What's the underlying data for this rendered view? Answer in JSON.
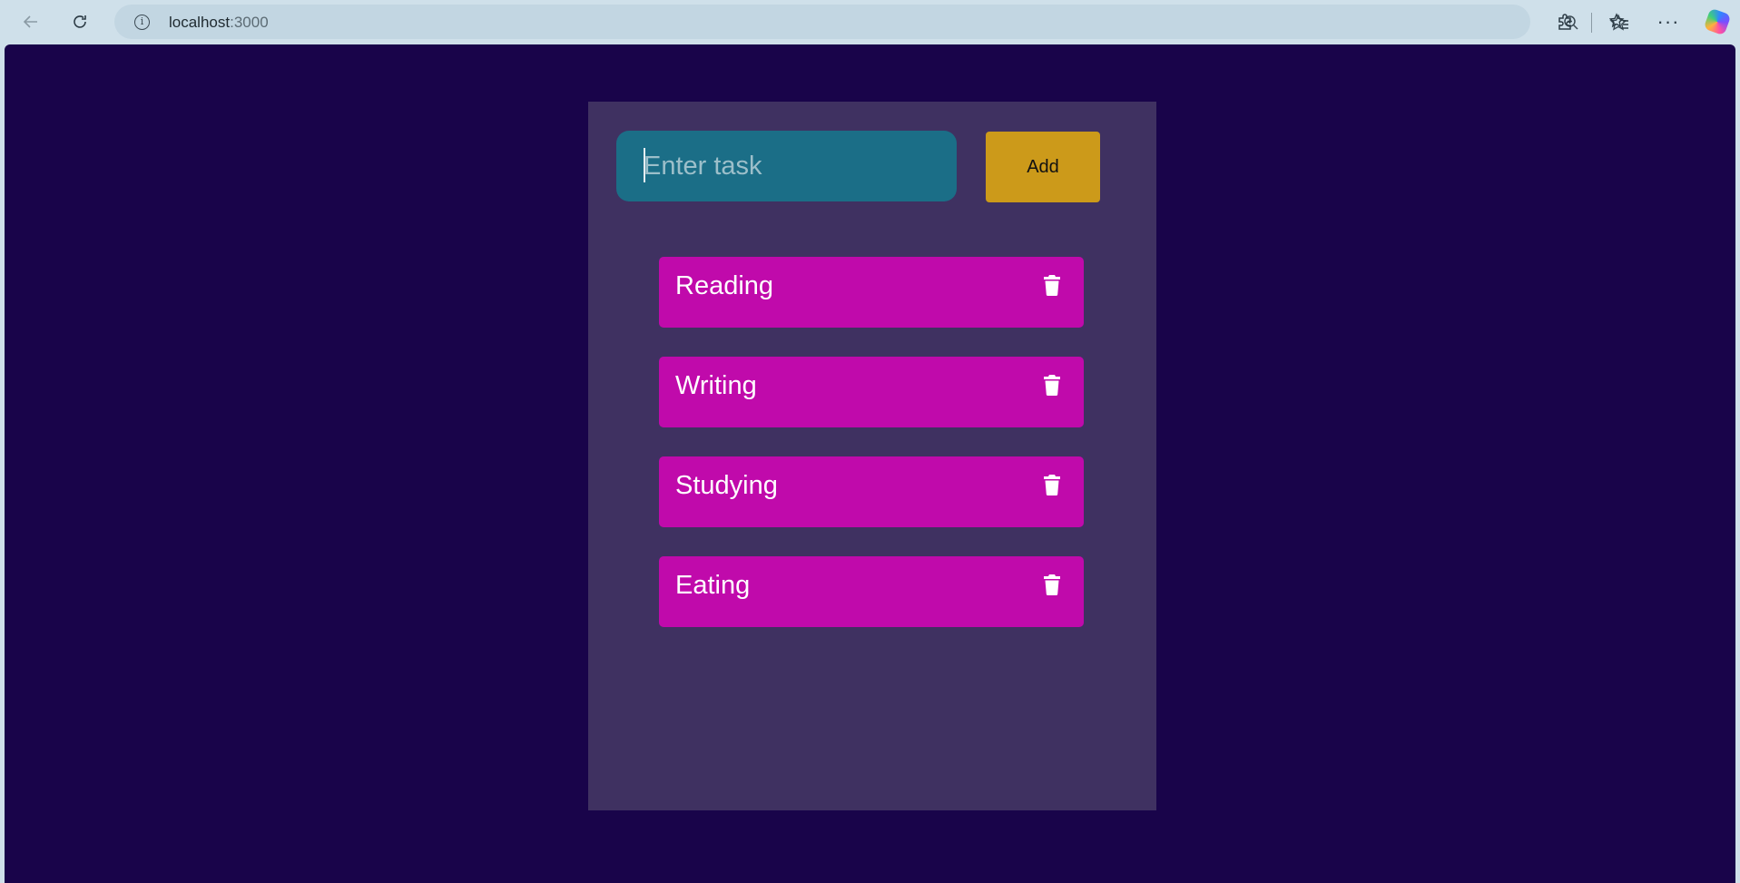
{
  "browser": {
    "url_host": "localhost",
    "url_port": ":3000",
    "icons": {
      "back": "back-arrow-icon",
      "reload": "reload-icon",
      "info": "info-icon",
      "zoom": "zoom-icon",
      "favorite": "star-icon",
      "extensions": "extensions-icon",
      "favorites_bar": "favorites-icon",
      "more": "more-icon",
      "copilot": "copilot-icon"
    }
  },
  "app": {
    "input": {
      "placeholder": "Enter task",
      "value": ""
    },
    "add_label": "Add",
    "tasks": [
      {
        "label": "Reading"
      },
      {
        "label": "Writing"
      },
      {
        "label": "Studying"
      },
      {
        "label": "Eating"
      }
    ],
    "colors": {
      "page_background": "#19044a",
      "card_background": "#3f3161",
      "input_background": "#1b6e87",
      "add_button": "#cc9a1a",
      "task_item": "#c00aab"
    }
  }
}
